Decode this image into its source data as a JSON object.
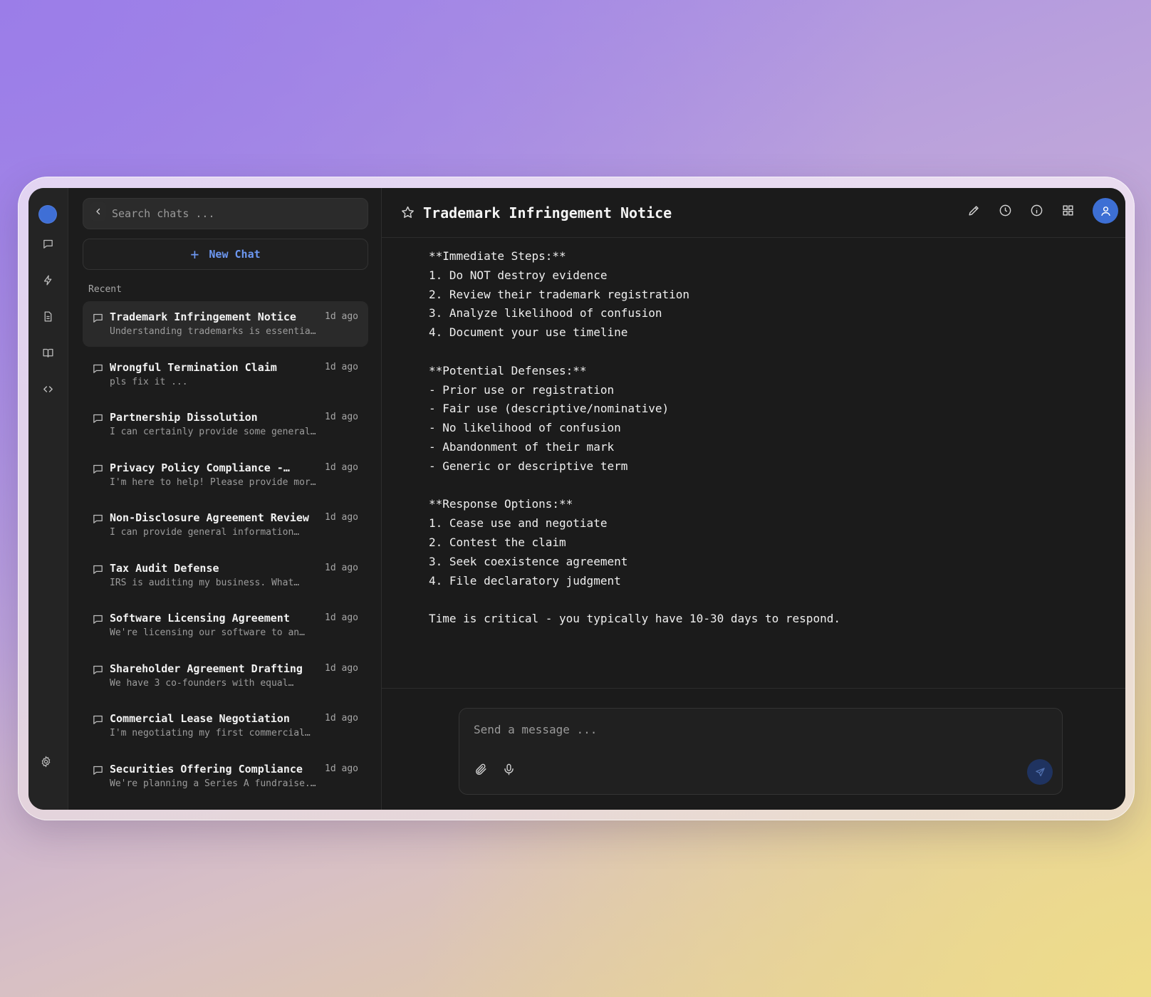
{
  "colors": {
    "accent": "#3f6fd6",
    "link": "#6d98f2",
    "background": "#1b1b1b",
    "sidebar": "#1c1c1c",
    "rail": "#242424"
  },
  "rail": {
    "icons": [
      "chat-icon",
      "bolt-icon",
      "document-icon",
      "book-icon",
      "code-icon",
      "gear-icon"
    ]
  },
  "sidebar": {
    "search_placeholder": "Search chats ...",
    "new_chat_label": "New Chat",
    "section_label": "Recent",
    "chats": [
      {
        "title": "Trademark Infringement Notice",
        "preview": "Understanding trademarks is essentia…",
        "time": "1d ago",
        "active": true
      },
      {
        "title": "Wrongful Termination Claim",
        "preview": "pls fix it ...",
        "time": "1d ago",
        "active": false
      },
      {
        "title": "Partnership Dissolution",
        "preview": "I can certainly provide some general…",
        "time": "1d ago",
        "active": false
      },
      {
        "title": "Privacy Policy Compliance -…",
        "preview": "I'm here to help! Please provide mor…",
        "time": "1d ago",
        "active": false
      },
      {
        "title": "Non-Disclosure Agreement Review",
        "preview": "I can provide general information…",
        "time": "1d ago",
        "active": false
      },
      {
        "title": "Tax Audit Defense",
        "preview": "IRS is auditing my business. What…",
        "time": "1d ago",
        "active": false
      },
      {
        "title": "Software Licensing Agreement",
        "preview": "We're licensing our software to an…",
        "time": "1d ago",
        "active": false
      },
      {
        "title": "Shareholder Agreement Drafting",
        "preview": "We have 3 co-founders with equal…",
        "time": "1d ago",
        "active": false
      },
      {
        "title": "Commercial Lease Negotiation",
        "preview": "I'm negotiating my first commercial…",
        "time": "1d ago",
        "active": false
      },
      {
        "title": "Securities Offering Compliance",
        "preview": "We're planning a Series A fundraise.…",
        "time": "1d ago",
        "active": false
      }
    ]
  },
  "header": {
    "title": "Trademark Infringement Notice",
    "icons": [
      "star-icon",
      "edit-icon",
      "clock-icon",
      "info-icon",
      "grid-icon",
      "user-avatar-icon"
    ]
  },
  "message": {
    "lines": [
      "**Immediate Steps:**",
      "1. Do NOT destroy evidence",
      "2. Review their trademark registration",
      "3. Analyze likelihood of confusion",
      "4. Document your use timeline",
      "",
      "**Potential Defenses:**",
      "- Prior use or registration",
      "- Fair use (descriptive/nominative)",
      "- No likelihood of confusion",
      "- Abandonment of their mark",
      "- Generic or descriptive term",
      "",
      "**Response Options:**",
      "1. Cease use and negotiate",
      "2. Contest the claim",
      "3. Seek coexistence agreement",
      "4. File declaratory judgment",
      "",
      "Time is critical - you typically have 10-30 days to respond."
    ]
  },
  "composer": {
    "placeholder": "Send a message ...",
    "icons": [
      "paperclip-icon",
      "microphone-icon",
      "send-icon"
    ]
  }
}
